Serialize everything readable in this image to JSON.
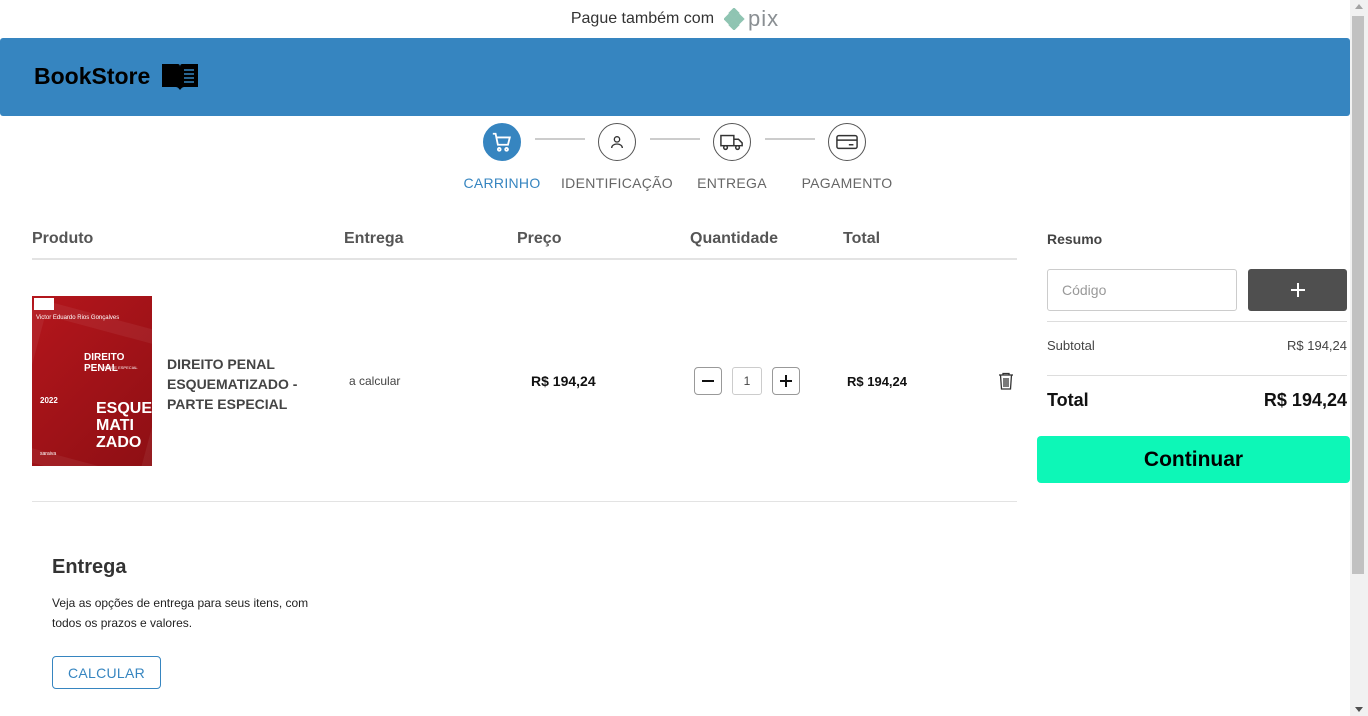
{
  "topbar": {
    "text": "Pague também com",
    "pix_logo": "pix"
  },
  "header": {
    "brand": "BookStore",
    "brand_icon": "open-book-icon",
    "color": "#3685c0"
  },
  "steps": [
    {
      "label": "CARRINHO",
      "icon": "cart-icon",
      "active": true
    },
    {
      "label": "IDENTIFICAÇÃO",
      "icon": "user-icon",
      "active": false
    },
    {
      "label": "ENTREGA",
      "icon": "truck-icon",
      "active": false
    },
    {
      "label": "PAGAMENTO",
      "icon": "card-icon",
      "active": false
    }
  ],
  "table": {
    "headers": {
      "product": "Produto",
      "delivery": "Entrega",
      "price": "Preço",
      "quantity": "Quantidade",
      "total": "Total"
    },
    "items": [
      {
        "name": "DIREITO PENAL ESQUEMATIZADO - PARTE ESPECIAL",
        "delivery": "a calcular",
        "price": "R$ 194,24",
        "quantity": "1",
        "total": "R$ 194,24",
        "cover": {
          "author": "Victor Eduardo Rios Gonçalves",
          "title": "DIREITO PENAL",
          "subtitle": "PARTE ESPECIAL",
          "year": "2022",
          "series": "ESQUE MATI ZADO",
          "publisher": "saraiva"
        }
      }
    ]
  },
  "delivery": {
    "title": "Entrega",
    "description": "Veja as opções de entrega para seus itens, com todos os prazos e valores.",
    "button": "CALCULAR"
  },
  "summary": {
    "title": "Resumo",
    "code_placeholder": "Código",
    "subtotal_label": "Subtotal",
    "subtotal_value": "R$ 194,24",
    "total_label": "Total",
    "total_value": "R$ 194,24",
    "continue_label": "Continuar",
    "continue_color": "#0df7b7"
  }
}
